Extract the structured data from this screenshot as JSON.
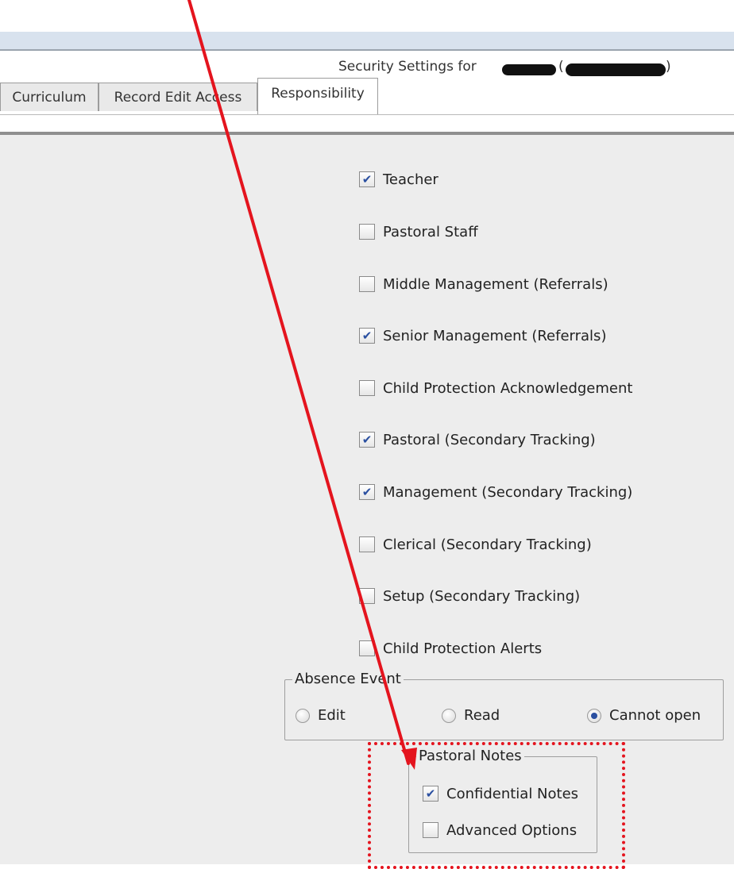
{
  "window": {
    "title": "Security Settings for",
    "title_open_paren": "(",
    "title_close_paren": ")"
  },
  "tabs": [
    {
      "label": "Curriculum",
      "active": false
    },
    {
      "label": "Record Edit Access",
      "active": false
    },
    {
      "label": "Responsibility",
      "active": true
    }
  ],
  "responsibilities": [
    {
      "label": "Teacher",
      "checked": true
    },
    {
      "label": "Pastoral Staff",
      "checked": false
    },
    {
      "label": "Middle Management (Referrals)",
      "checked": false
    },
    {
      "label": "Senior Management (Referrals)",
      "checked": true
    },
    {
      "label": "Child Protection Acknowledgement",
      "checked": false
    },
    {
      "label": "Pastoral (Secondary Tracking)",
      "checked": true
    },
    {
      "label": "Management (Secondary Tracking)",
      "checked": true
    },
    {
      "label": "Clerical (Secondary Tracking)",
      "checked": false
    },
    {
      "label": "Setup (Secondary Tracking)",
      "checked": false
    },
    {
      "label": "Child Protection Alerts",
      "checked": false
    }
  ],
  "absence_event": {
    "title": "Absence Event",
    "options": [
      {
        "label": "Edit",
        "selected": false
      },
      {
        "label": "Read",
        "selected": false
      },
      {
        "label": "Cannot open",
        "selected": true
      }
    ]
  },
  "pastoral_notes": {
    "title": "Pastoral Notes",
    "items": [
      {
        "label": "Confidential Notes",
        "checked": true
      },
      {
        "label": "Advanced Options",
        "checked": false
      }
    ]
  },
  "colors": {
    "annotation": "#e4141e",
    "check": "#2a4fa0",
    "panel": "#ededed"
  }
}
